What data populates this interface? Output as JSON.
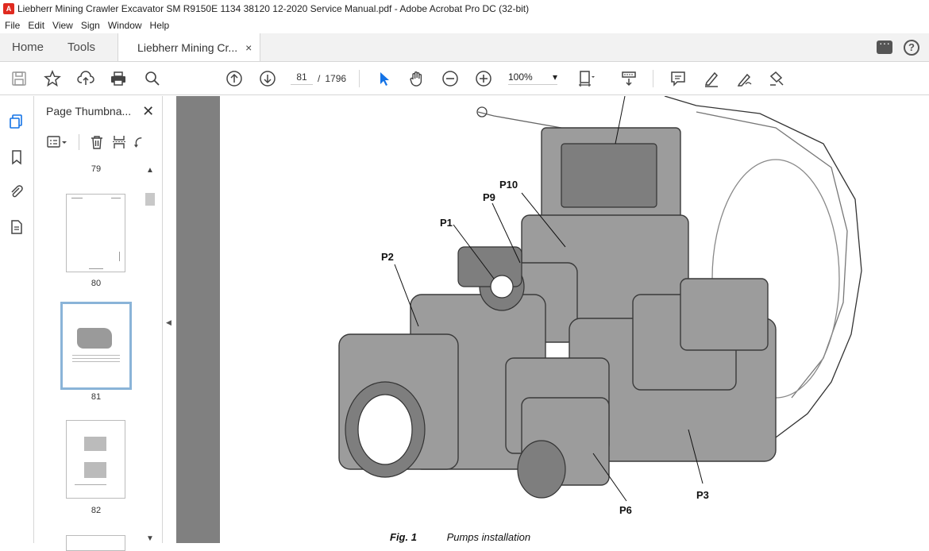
{
  "window": {
    "title": "Liebherr Mining Crawler Excavator SM R9150E 1134 38120 12-2020 Service Manual.pdf - Adobe Acrobat Pro DC (32-bit)"
  },
  "menu": [
    "File",
    "Edit",
    "View",
    "Sign",
    "Window",
    "Help"
  ],
  "tabs": {
    "home": "Home",
    "tools": "Tools",
    "document": "Liebherr Mining Cr...",
    "close": "×"
  },
  "toolbar": {
    "current_page": "81",
    "separator": "/",
    "total_pages": "1796",
    "zoom": "100%",
    "zoom_arrow": "▾"
  },
  "thumbnails": {
    "title": "Page Thumbna...",
    "close": "✕",
    "pages": [
      "79",
      "80",
      "81",
      "82"
    ],
    "selected": "81"
  },
  "document": {
    "callouts": [
      "P10",
      "P9",
      "P1",
      "P2",
      "P6",
      "P3"
    ],
    "figure_label": "Fig. 1",
    "figure_caption": "Pumps installation"
  },
  "colors": {
    "accent": "#1473e6",
    "doc_background": "#808080",
    "selection": "#8ab4d8"
  }
}
